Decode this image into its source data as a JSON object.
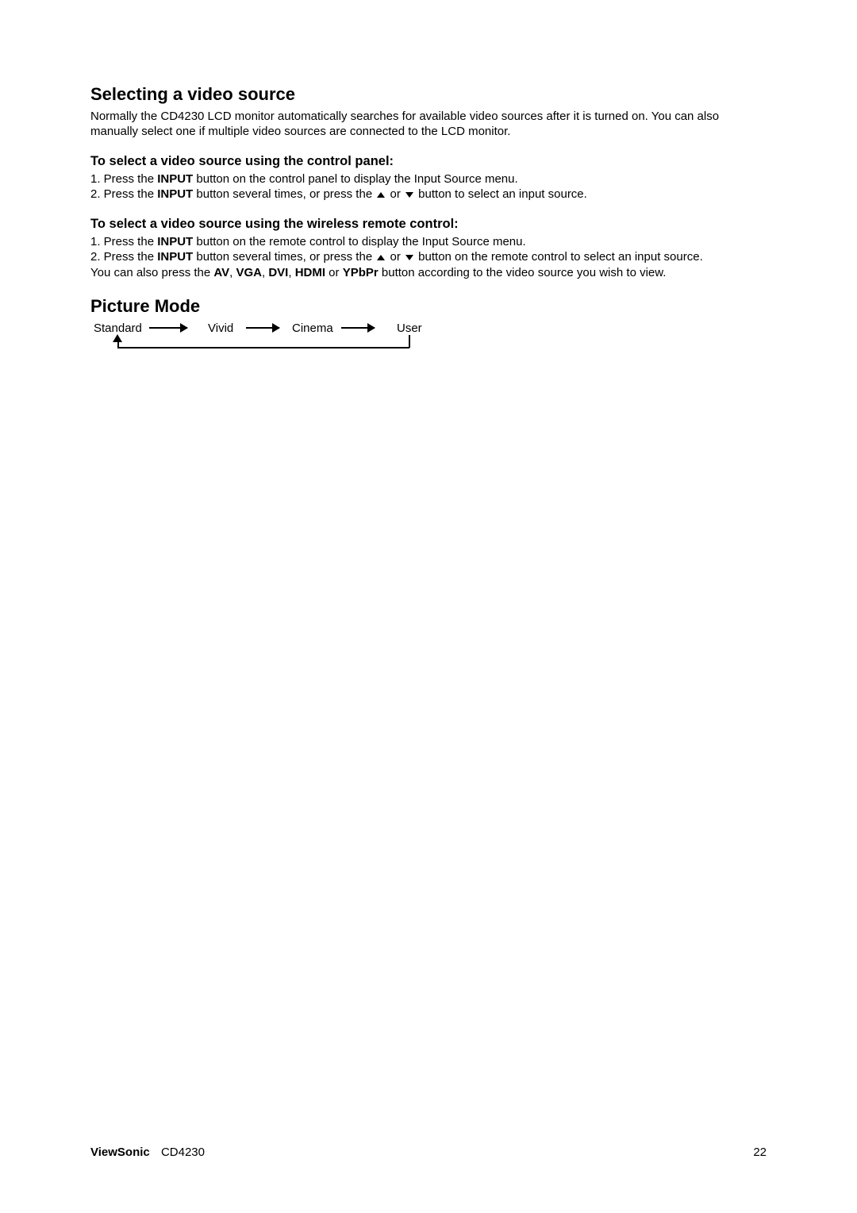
{
  "section1": {
    "heading": "Selecting a video source",
    "intro": "Normally the CD4230 LCD monitor automatically searches for available video sources after it is turned on. You can also manually select one if multiple video sources are connected to the LCD monitor.",
    "sub1": {
      "heading": "To select a video source using the control panel:",
      "step1_prefix": "1. Press the ",
      "step1_bold": "INPUT",
      "step1_suffix": " button on the control panel to display the Input Source menu.",
      "step2_prefix": "2. Press the ",
      "step2_bold": "INPUT",
      "step2_mid": " button several times, or press the ",
      "step2_or": " or ",
      "step2_suffix": " button to select an input source."
    },
    "sub2": {
      "heading": "To select a video source using the wireless remote control:",
      "step1_prefix": "1. Press the ",
      "step1_bold": "INPUT",
      "step1_suffix": " button on the remote control to display the Input Source menu.",
      "step2_prefix": "2. Press the ",
      "step2_bold": "INPUT",
      "step2_mid": " button several times, or press the ",
      "step2_or": " or ",
      "step2_suffix": " button on the remote control to select an input source.",
      "note_prefix": "You can also press the ",
      "note_av": "AV",
      "note_c1": ", ",
      "note_vga": "VGA",
      "note_c2": ", ",
      "note_dvi": "DVI",
      "note_c3": ", ",
      "note_hdmi": "HDMI",
      "note_or": " or ",
      "note_ypbpr": "YPbPr",
      "note_suffix": " button according to the video source you wish to view."
    }
  },
  "section2": {
    "heading": "Picture Mode",
    "modes": {
      "standard": "Standard",
      "vivid": "Vivid",
      "cinema": "Cinema",
      "user": "User"
    }
  },
  "footer": {
    "brand": "ViewSonic",
    "model": "CD4230",
    "page": "22"
  }
}
